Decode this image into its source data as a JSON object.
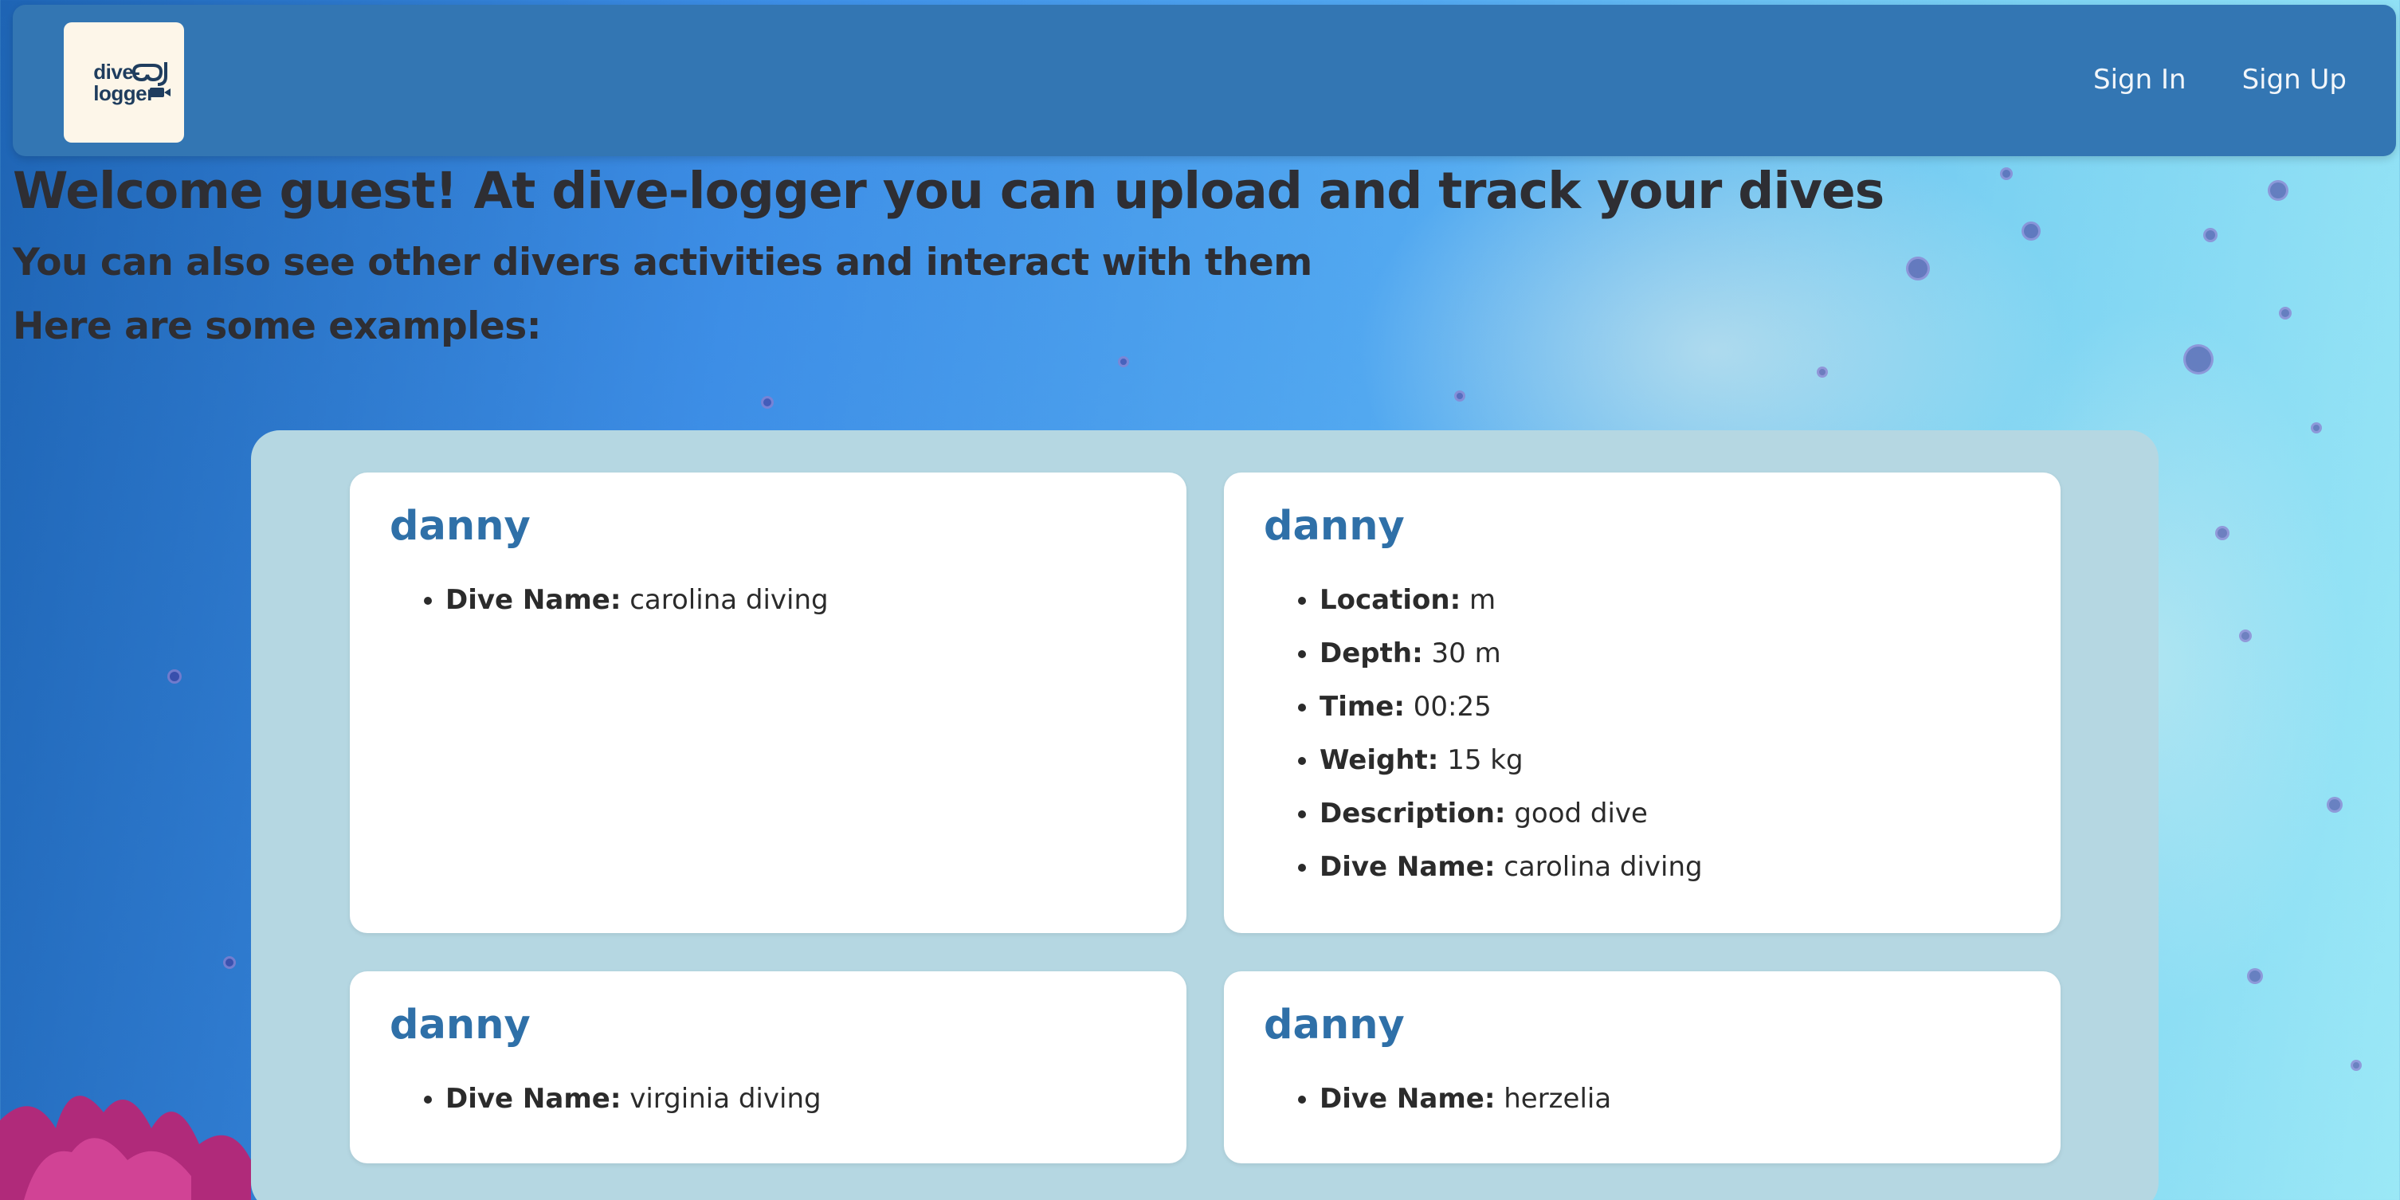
{
  "header": {
    "logo_text_line1": "dive-",
    "logo_text_line2": "logger",
    "nav": [
      {
        "label": "Sign In"
      },
      {
        "label": "Sign Up"
      }
    ]
  },
  "intro": {
    "title": "Welcome guest! At dive-logger you can upload and track your dives",
    "subtitle": "You can also see other divers activities and interact with them",
    "examples_heading": "Here are some examples:"
  },
  "cards": [
    {
      "user": "danny",
      "fields": [
        {
          "label": "Dive Name:",
          "value": "carolina diving"
        }
      ]
    },
    {
      "user": "danny",
      "fields": [
        {
          "label": "Location:",
          "value": "m"
        },
        {
          "label": "Depth:",
          "value": "30 m"
        },
        {
          "label": "Time:",
          "value": "00:25"
        },
        {
          "label": "Weight:",
          "value": "15 kg"
        },
        {
          "label": "Description:",
          "value": "good dive"
        },
        {
          "label": "Dive Name:",
          "value": "carolina diving"
        }
      ]
    },
    {
      "user": "danny",
      "fields": [
        {
          "label": "Dive Name:",
          "value": "virginia diving"
        }
      ]
    },
    {
      "user": "danny",
      "fields": [
        {
          "label": "Dive Name:",
          "value": "herzelia"
        }
      ]
    }
  ],
  "colors": {
    "navbar": "#3376b3",
    "card_title": "#2f70a8",
    "panel": "#b5d7e2",
    "logo_bg": "#fdf6e9"
  }
}
